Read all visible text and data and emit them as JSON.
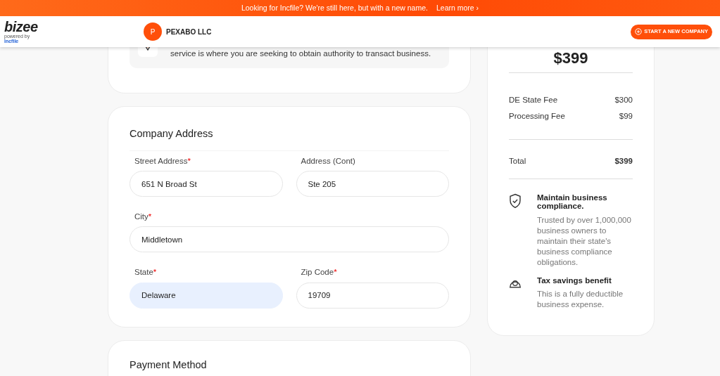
{
  "banner": {
    "message": "Looking for Incfile? We're still here, but with a new name.",
    "link": "Learn more",
    "link_arrow": "›"
  },
  "header": {
    "logo": "bizee",
    "logo_tagline_prefix": "powered by",
    "logo_tagline_brand": "incfile",
    "company_initial": "P",
    "company_name": "PEXABO LLC",
    "new_company_button": "START A NEW COMPANY"
  },
  "info_note": {
    "text": "service is where you are seeking to obtain authority to transact business."
  },
  "company_address": {
    "title": "Company Address",
    "rows": [
      [
        {
          "label": "Street Address",
          "required_mark": "*",
          "value": "651 N Broad St",
          "autofilled": false
        },
        {
          "label": "Address (Cont)",
          "value": "Ste 205",
          "autofilled": false
        }
      ],
      [
        {
          "label": "City",
          "required_mark": "*",
          "value": "Middletown",
          "autofilled": false
        }
      ],
      [
        {
          "label": "State",
          "required_mark": "*",
          "value": "Delaware",
          "autofilled": true
        },
        {
          "label": "Zip Code",
          "required_mark": "*",
          "value": "19709",
          "autofilled": false
        }
      ]
    ]
  },
  "payment_method": {
    "title": "Payment Method"
  },
  "order_summary": {
    "price": "$399",
    "fees": [
      {
        "name": "DE State Fee",
        "amount": "$300"
      },
      {
        "name": "Processing Fee",
        "amount": "$99"
      }
    ],
    "total_label": "Total",
    "total_amount": "$399",
    "benefits": [
      {
        "title": "Maintain business compliance.",
        "text": "Trusted by over 1,000,000 business owners to maintain their state's business compliance obligations."
      },
      {
        "title": "Tax savings benefit",
        "text": "This is a fully deductible business expense."
      }
    ]
  }
}
